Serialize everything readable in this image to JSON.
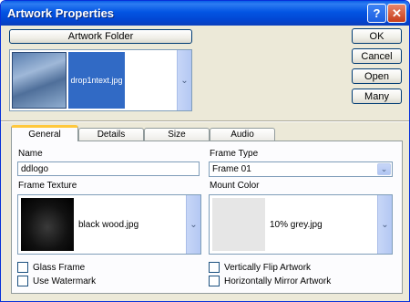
{
  "window": {
    "title": "Artwork Properties",
    "help_glyph": "?",
    "close_glyph": "✕"
  },
  "top": {
    "artwork_folder_label": "Artwork Folder",
    "thumbnails": [
      {
        "label": "",
        "color": "#7a9ac4"
      },
      {
        "label": "drop1ntext.jpg",
        "color": "#316ac5"
      }
    ]
  },
  "buttons": {
    "ok": "OK",
    "cancel": "Cancel",
    "open": "Open",
    "many": "Many"
  },
  "tabs": [
    "General",
    "Details",
    "Size",
    "Audio"
  ],
  "active_tab": "General",
  "general": {
    "name_label": "Name",
    "name_value": "ddlogo",
    "frame_type_label": "Frame Type",
    "frame_type_value": "Frame 01",
    "frame_texture_label": "Frame Texture",
    "frame_texture_value": "black wood.jpg",
    "mount_color_label": "Mount Color",
    "mount_color_value": "10% grey.jpg",
    "checkboxes": {
      "glass_frame": "Glass Frame",
      "use_watermark": "Use Watermark",
      "vertical_flip": "Vertically Flip Artwork",
      "horizontal_mirror": "Horizontally Mirror Artwork"
    }
  },
  "icons": {
    "scroll_down": "chevron-down-icon"
  },
  "colors": {
    "title_bar": "#0355e3",
    "selection": "#316ac5",
    "active_tab_accent": "#ffc83c"
  }
}
